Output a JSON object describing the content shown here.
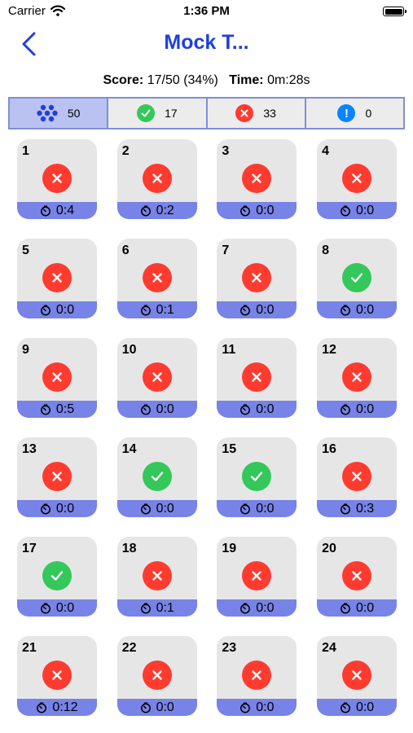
{
  "status": {
    "carrier": "Carrier",
    "time": "1:36 PM"
  },
  "header": {
    "title": "Mock T..."
  },
  "score": {
    "score_label": "Score:",
    "score_value": "17/50 (34%)",
    "time_label": "Time:",
    "time_value": "0m:28s"
  },
  "summary": [
    {
      "type": "all",
      "count": "50",
      "icon": "dots-grid-icon"
    },
    {
      "type": "correct",
      "count": "17",
      "icon": "checkmark-icon"
    },
    {
      "type": "wrong",
      "count": "33",
      "icon": "x-icon"
    },
    {
      "type": "unanswered",
      "count": "0",
      "icon": "exclamation-icon"
    }
  ],
  "questions": [
    {
      "number": "1",
      "result": "wrong",
      "time": "0:4"
    },
    {
      "number": "2",
      "result": "wrong",
      "time": "0:2"
    },
    {
      "number": "3",
      "result": "wrong",
      "time": "0:0"
    },
    {
      "number": "4",
      "result": "wrong",
      "time": "0:0"
    },
    {
      "number": "5",
      "result": "wrong",
      "time": "0:0"
    },
    {
      "number": "6",
      "result": "wrong",
      "time": "0:1"
    },
    {
      "number": "7",
      "result": "wrong",
      "time": "0:0"
    },
    {
      "number": "8",
      "result": "right",
      "time": "0:0"
    },
    {
      "number": "9",
      "result": "wrong",
      "time": "0:5"
    },
    {
      "number": "10",
      "result": "wrong",
      "time": "0:0"
    },
    {
      "number": "11",
      "result": "wrong",
      "time": "0:0"
    },
    {
      "number": "12",
      "result": "wrong",
      "time": "0:0"
    },
    {
      "number": "13",
      "result": "wrong",
      "time": "0:0"
    },
    {
      "number": "14",
      "result": "right",
      "time": "0:0"
    },
    {
      "number": "15",
      "result": "right",
      "time": "0:0"
    },
    {
      "number": "16",
      "result": "wrong",
      "time": "0:3"
    },
    {
      "number": "17",
      "result": "right",
      "time": "0:0"
    },
    {
      "number": "18",
      "result": "wrong",
      "time": "0:1"
    },
    {
      "number": "19",
      "result": "wrong",
      "time": "0:0"
    },
    {
      "number": "20",
      "result": "wrong",
      "time": "0:0"
    },
    {
      "number": "21",
      "result": "wrong",
      "time": "0:12"
    },
    {
      "number": "22",
      "result": "wrong",
      "time": "0:0"
    },
    {
      "number": "23",
      "result": "wrong",
      "time": "0:0"
    },
    {
      "number": "24",
      "result": "wrong",
      "time": "0:0"
    }
  ],
  "colors": {
    "accent": "#1f3fe0",
    "correct": "#34c759",
    "wrong": "#ff3b30",
    "unanswered": "#0a84ff",
    "timer_bar": "#7783e6",
    "selected_segment": "#b9c2f0"
  }
}
